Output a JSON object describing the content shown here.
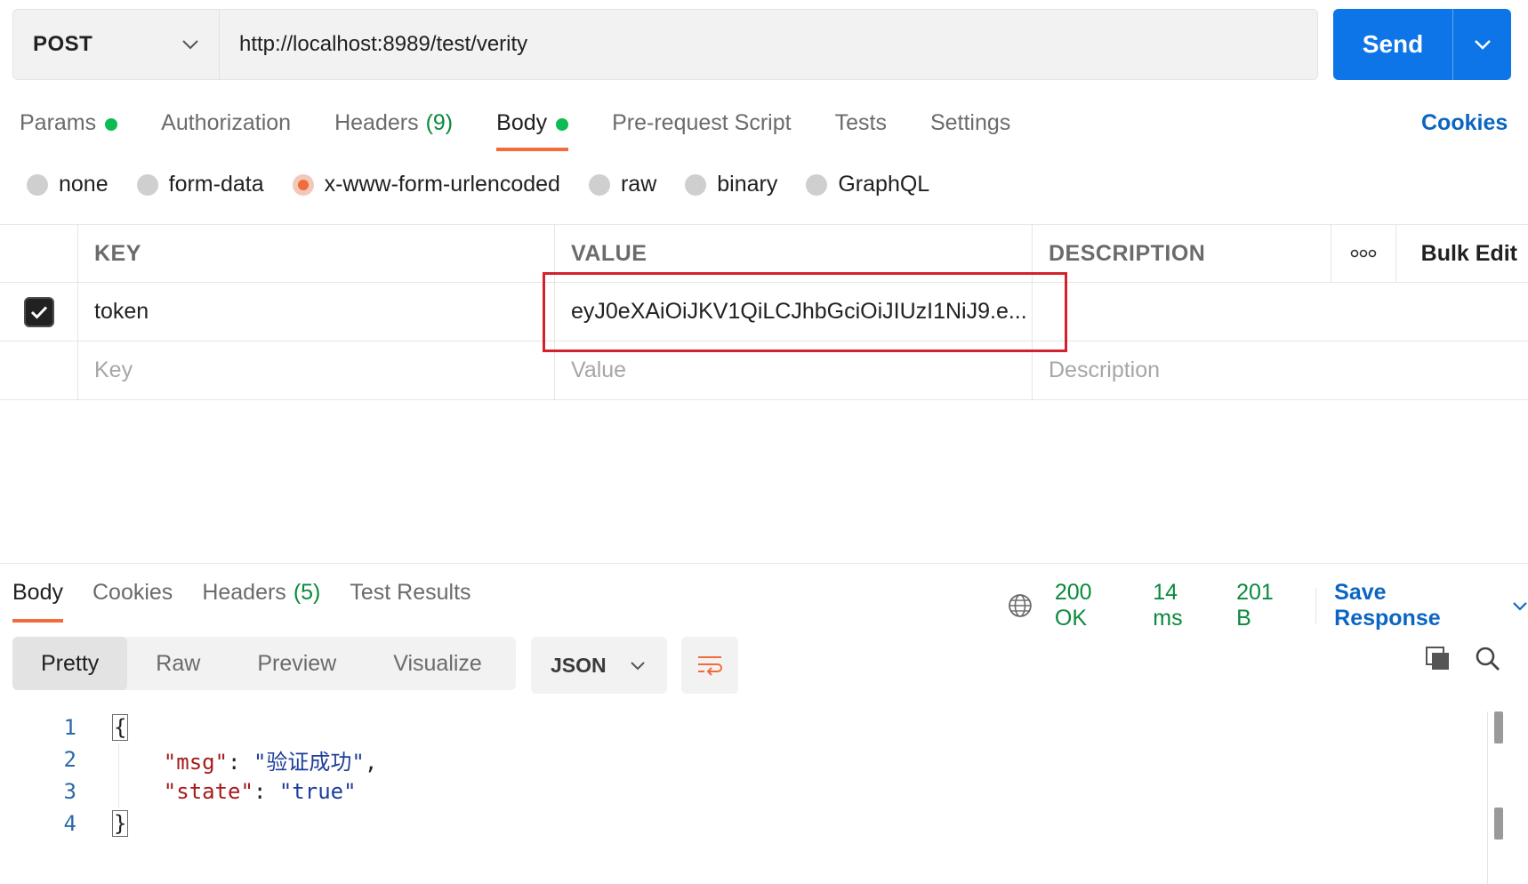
{
  "request": {
    "method": "POST",
    "url": "http://localhost:8989/test/verity",
    "send_label": "Send"
  },
  "req_tabs": [
    {
      "label": "Params",
      "dot": true
    },
    {
      "label": "Authorization"
    },
    {
      "label": "Headers",
      "count": "(9)"
    },
    {
      "label": "Body",
      "dot": true,
      "active": true
    },
    {
      "label": "Pre-request Script"
    },
    {
      "label": "Tests"
    },
    {
      "label": "Settings"
    }
  ],
  "cookies_label": "Cookies",
  "body_types": [
    {
      "label": "none"
    },
    {
      "label": "form-data"
    },
    {
      "label": "x-www-form-urlencoded",
      "selected": true
    },
    {
      "label": "raw"
    },
    {
      "label": "binary"
    },
    {
      "label": "GraphQL"
    }
  ],
  "params_table": {
    "headers": {
      "key": "KEY",
      "value": "VALUE",
      "description": "DESCRIPTION",
      "bulk_edit": "Bulk Edit"
    },
    "rows": [
      {
        "key": "token",
        "value": "eyJ0eXAiOiJKV1QiLCJhbGciOiJIUzI1NiJ9.e...",
        "description": "",
        "checked": true
      }
    ],
    "placeholders": {
      "key": "Key",
      "value": "Value",
      "description": "Description"
    }
  },
  "response": {
    "tabs": [
      {
        "label": "Body",
        "active": true
      },
      {
        "label": "Cookies"
      },
      {
        "label": "Headers",
        "count": "(5)"
      },
      {
        "label": "Test Results"
      }
    ],
    "status": "200 OK",
    "time": "14 ms",
    "size": "201 B",
    "save_label": "Save Response",
    "views": [
      "Pretty",
      "Raw",
      "Preview",
      "Visualize"
    ],
    "format": "JSON",
    "code_lines": [
      {
        "n": "1"
      },
      {
        "n": "2",
        "key": "\"msg\"",
        "colon": ": ",
        "val": "\"验证成功\"",
        "tail": ","
      },
      {
        "n": "3",
        "key": "\"state\"",
        "colon": ": ",
        "val": "\"true\"",
        "tail": ""
      },
      {
        "n": "4"
      }
    ],
    "open_brace": "{",
    "close_brace": "}"
  },
  "colors": {
    "accent": "#0d75e8",
    "active_tab": "#f26b3a",
    "success": "#0a8a3c",
    "link": "#0b65c2",
    "highlight": "#d2222d"
  }
}
